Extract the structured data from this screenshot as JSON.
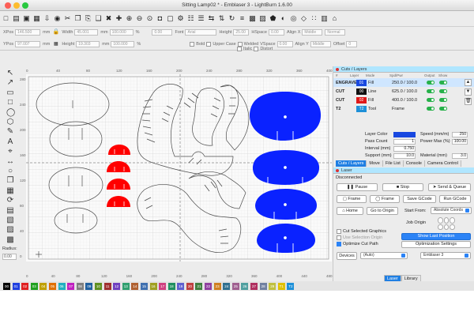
{
  "window": {
    "title": "Sitting Lamp02 * - Emblaser 3 - LightBurn 1.6.00"
  },
  "toolbar": {
    "icons": [
      "new-icon",
      "open-icon",
      "save-icon",
      "save-as-icon",
      "import-icon",
      "lightburn-icon",
      "cut-icon",
      "copy-icon",
      "paste-icon",
      "duplicate-icon",
      "delete-icon",
      "move-icon",
      "zoom-in-icon",
      "zoom-out-icon",
      "zoom-page-icon",
      "camera-icon",
      "frame-icon",
      "settings-icon",
      "arrange-icon",
      "distribute-icon",
      "flip-icon",
      "mirror-icon",
      "rotate-icon",
      "align-icon",
      "group-icon",
      "ungroup-icon",
      "weld-icon",
      "boolean-icon",
      "offset-icon",
      "node-icon",
      "array-icon",
      "dock-icon",
      "machine-icon"
    ]
  },
  "numeric": {
    "xpos_label": "XPos",
    "xpos_value": "146.500",
    "ypos_label": "YPos",
    "ypos_value": "97.007",
    "unit": "mm",
    "width_label": "Width",
    "width_value": "45.001",
    "height_label": "Height",
    "height_value": "19.303",
    "scale_x": "100.000",
    "scale_y": "100.000",
    "percent": "%",
    "rotate_value": "0.00",
    "font_label": "Font",
    "font_value": "Arial",
    "height2_label": "Height",
    "height2_value": "25.00",
    "hspace_label": "HSpace",
    "hspace_value": "0.00",
    "align_x_label": "Align X",
    "align_x_value": "Middle",
    "normal_value": "Normal",
    "bold_label": "Bold",
    "upper_case_label": "Upper Case",
    "welded_label": "Welded",
    "italic_label": "Italic",
    "distort_label": "Distort",
    "vspace_label": "VSpace",
    "vspace_value": "0.00",
    "align_y_label": "Align Y",
    "align_y_value": "Middle",
    "offset_label": "Offset",
    "offset_value": "0"
  },
  "left_tools": {
    "icons": [
      "select-arrow-icon",
      "edit-nodes-icon",
      "rectangle-icon",
      "square-icon",
      "ellipse-icon",
      "polygon-icon",
      "pen-icon",
      "text-icon",
      "position-icon",
      "measure-icon",
      "circle-tool-icon",
      "copy-along-path-icon",
      "grid-array-icon",
      "circular-array-icon",
      "nest-icon",
      "trace-icon",
      "align-tool-icon",
      "snap-icon"
    ],
    "radius_label": "Radius:",
    "radius_value": "0.00"
  },
  "rulers": {
    "top": [
      "0",
      "40",
      "80",
      "120",
      "160",
      "200",
      "240",
      "280",
      "320",
      "360",
      "400"
    ],
    "left": [
      "280",
      "240",
      "200",
      "160",
      "120",
      "80",
      "40",
      "0"
    ],
    "bottom": [
      "0",
      "40",
      "80",
      "120",
      "160",
      "200",
      "240",
      "280",
      "320",
      "360",
      "400",
      "440",
      "480"
    ]
  },
  "colors": {
    "shape_red": "#ff0000",
    "shape_blue": "#0a22ff",
    "shape_outline": "#4c4c4c",
    "accent_blue": "#2b83f6",
    "toggle_green": "#27b14a"
  },
  "cuts_layers": {
    "title": "Cuts / Layers",
    "col_num": "#",
    "col_layer": "Layer",
    "col_mode": "Mode",
    "col_spd": "Spd/Pwr",
    "col_output": "Output",
    "col_show": "Show",
    "rows": [
      {
        "mode": "ENGRAVE",
        "layer": "01",
        "color": "#1848e0",
        "type": "Fill",
        "speed": "250.0 / 100.0"
      },
      {
        "mode": "CUT",
        "layer": "00",
        "color": "#111111",
        "type": "Line",
        "speed": "625.0 / 100.0"
      },
      {
        "mode": "CUT",
        "layer": "02",
        "color": "#e01818",
        "type": "Fill",
        "speed": "400.0 / 100.0"
      },
      {
        "mode": "T2",
        "layer": "T2",
        "color": "#1e90d8",
        "type": "Tool",
        "speed": "Frame"
      }
    ],
    "layer_color_label": "Layer Color",
    "speed_label": "Speed (mm/m)",
    "speed_value": "250",
    "pass_count_label": "Pass Count",
    "pass_count_value": "1",
    "power_max_label": "Power Max (%)",
    "power_max_value": "100.00",
    "interval_label": "Interval (mm)",
    "interval_value": "0.750",
    "support_label": "Support (mm)",
    "support_value": "10.0",
    "material_label": "Material (mm)",
    "material_value": "3.0"
  },
  "panel_tabs": [
    "Cuts / Layers",
    "Move",
    "File List",
    "Console",
    "Camera Control"
  ],
  "laser": {
    "title": "Laser",
    "status": "Disconnected",
    "pause_label": "Pause",
    "stop_label": "Stop",
    "send_queue_label": "Send & Queue",
    "frame1_label": "Frame",
    "frame2_label": "Frame",
    "save_gcode_label": "Save GCode",
    "run_gcode_label": "Run GCode",
    "home_label": "Home",
    "go_to_origin_label": "Go to Origin",
    "start_from_label": "Start From:",
    "start_from_value": "Absolute Coords",
    "job_origin_label": "Job Origin",
    "cut_selected_label": "Cut Selected Graphics",
    "use_selection_origin_label": "Use Selection Origin",
    "show_last_position_label": "Show Last Position",
    "optimize_cut_path_label": "Optimize Cut Path",
    "optimization_settings_label": "Optimization Settings",
    "devices_label": "Devices",
    "devices_value": "(Auto)",
    "machine_value": "Emblaser 3"
  },
  "bottom_tabs": [
    "Laser",
    "Library"
  ],
  "palette": [
    {
      "label": "00",
      "color": "#000000"
    },
    {
      "label": "01",
      "color": "#2040e0"
    },
    {
      "label": "02",
      "color": "#e02020"
    },
    {
      "label": "03",
      "color": "#20a020"
    },
    {
      "label": "04",
      "color": "#c0a000"
    },
    {
      "label": "05",
      "color": "#e07000"
    },
    {
      "label": "06",
      "color": "#20b0c0"
    },
    {
      "label": "07",
      "color": "#c020c0"
    },
    {
      "label": "08",
      "color": "#808080"
    },
    {
      "label": "09",
      "color": "#2060a0"
    },
    {
      "label": "10",
      "color": "#609020"
    },
    {
      "label": "11",
      "color": "#a03030"
    },
    {
      "label": "12",
      "color": "#7040c0"
    },
    {
      "label": "13",
      "color": "#30a070"
    },
    {
      "label": "14",
      "color": "#b06030"
    },
    {
      "label": "15",
      "color": "#4070b0"
    },
    {
      "label": "16",
      "color": "#a0a020"
    },
    {
      "label": "17",
      "color": "#d04080"
    },
    {
      "label": "18",
      "color": "#209060"
    },
    {
      "label": "19",
      "color": "#6060d0"
    },
    {
      "label": "20",
      "color": "#c04040"
    },
    {
      "label": "21",
      "color": "#408040"
    },
    {
      "label": "22",
      "color": "#9040a0"
    },
    {
      "label": "23",
      "color": "#d08020"
    },
    {
      "label": "24",
      "color": "#307090"
    },
    {
      "label": "25",
      "color": "#a06090"
    },
    {
      "label": "26",
      "color": "#50a0a0"
    },
    {
      "label": "27",
      "color": "#b03060"
    },
    {
      "label": "28",
      "color": "#7080a0"
    },
    {
      "label": "29",
      "color": "#c0c040"
    },
    {
      "label": "T1",
      "color": "#e0c000"
    },
    {
      "label": "T2",
      "color": "#1e90d8"
    }
  ]
}
